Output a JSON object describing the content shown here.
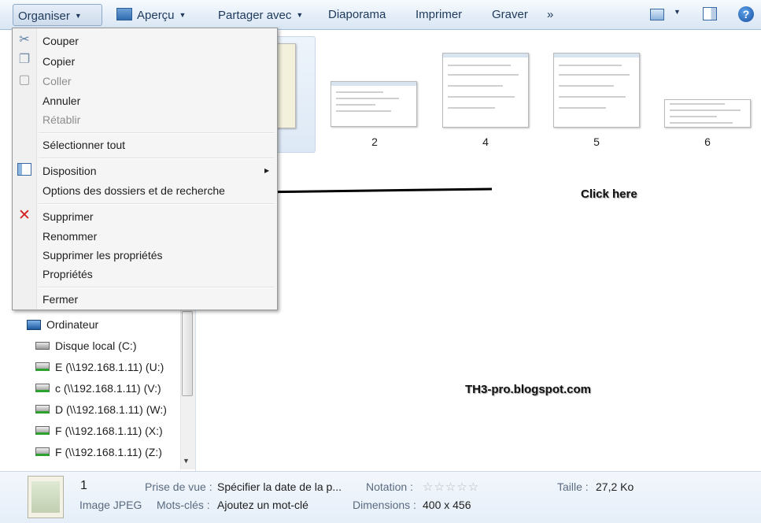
{
  "toolbar": {
    "organize_label": "Organiser",
    "preview_label": "Aperçu",
    "share_label": "Partager avec",
    "slideshow_label": "Diaporama",
    "print_label": "Imprimer",
    "burn_label": "Graver",
    "more_label": "»",
    "help_label": "?"
  },
  "menu": {
    "cut": "Couper",
    "copy": "Copier",
    "paste": "Coller",
    "undo": "Annuler",
    "redo": "Rétablir",
    "select_all": "Sélectionner tout",
    "layout": "Disposition",
    "folder_options": "Options des dossiers et de recherche",
    "delete": "Supprimer",
    "rename": "Renommer",
    "remove_properties": "Supprimer les propriétés",
    "properties": "Propriétés",
    "close": "Fermer"
  },
  "nav": {
    "computer": "Ordinateur",
    "drives": [
      "Disque local (C:)",
      "E (\\\\192.168.1.11) (U:)",
      "c (\\\\192.168.1.11) (V:)",
      "D (\\\\192.168.1.11) (W:)",
      "F (\\\\192.168.1.11) (X:)",
      "F (\\\\192.168.1.11) (Z:)"
    ]
  },
  "thumbnails": [
    "2",
    "4",
    "5",
    "6"
  ],
  "annotations": {
    "click_here": "Click here",
    "watermark": "TH3-pro.blogspot.com"
  },
  "details": {
    "name": "1",
    "type": "Image JPEG",
    "date_taken_key": "Prise de vue :",
    "date_taken_val": "Spécifier la date de la p...",
    "tags_key": "Mots-clés :",
    "tags_val": "Ajoutez un mot-clé",
    "rating_key": "Notation :",
    "rating_stars": "☆☆☆☆☆",
    "dimensions_key": "Dimensions :",
    "dimensions_val": "400 x 456",
    "size_key": "Taille :",
    "size_val": "27,2 Ko"
  },
  "colors": {
    "toolbar_text": "#1e395b",
    "arrow": "#000000",
    "delete_icon": "#d42020"
  }
}
